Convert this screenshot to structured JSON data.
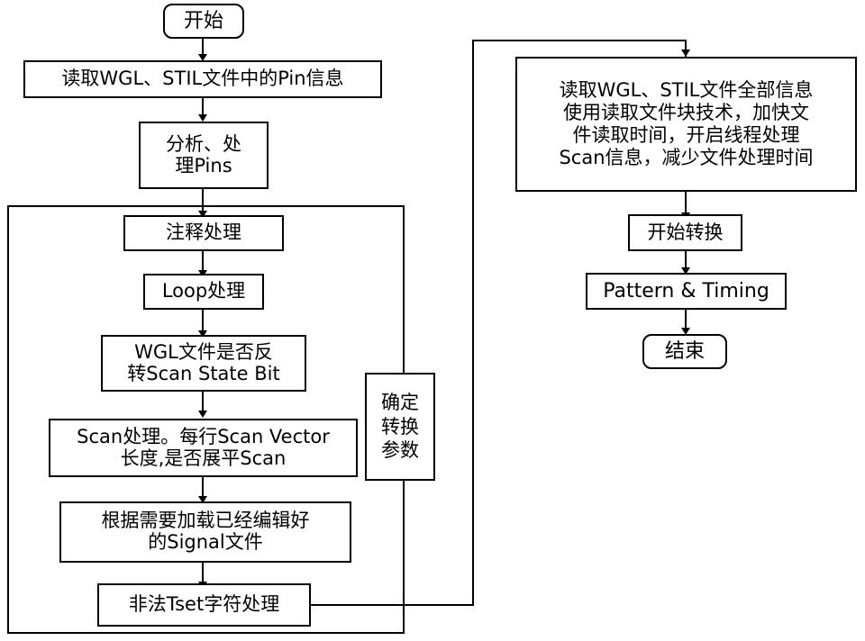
{
  "diagram": {
    "title": "WGL/STIL 文件转换流程图",
    "nodes": {
      "start": {
        "label": "开始",
        "shape": "rounded-rect"
      },
      "read_pin_info": {
        "label": "读取WGL、STIL文件中的Pin信息",
        "shape": "rect"
      },
      "analyze_pins": {
        "label": "分析、处\n理Pins",
        "shape": "rect"
      },
      "comment_process": {
        "label": "注释处理",
        "shape": "rect"
      },
      "loop_process": {
        "label": "Loop处理",
        "shape": "rect"
      },
      "wgl_invert_scan": {
        "label": "WGL文件是否反\n转Scan State Bit",
        "shape": "rect"
      },
      "scan_process": {
        "label": "Scan处理。每行Scan Vector\n长度,是否展平Scan",
        "shape": "rect"
      },
      "load_signal_file": {
        "label": "根据需要加载已经编辑好\n的Signal文件",
        "shape": "rect"
      },
      "illegal_tset": {
        "label": "非法Tset字符处理",
        "shape": "rect"
      },
      "confirm_params": {
        "label": "确定\n转换\n参数",
        "shape": "rect"
      },
      "read_all_info": {
        "label": "读取WGL、STIL文件全部信息\n使用读取文件块技术，加快文\n件读取时间，开启线程处理\nScan信息，减少文件处理时间",
        "shape": "rect"
      },
      "start_convert": {
        "label": "开始转换",
        "shape": "rect"
      },
      "pattern_timing": {
        "label": "Pattern & Timing",
        "shape": "rect"
      },
      "end": {
        "label": "结束",
        "shape": "rounded-rect"
      }
    },
    "colors": {
      "stroke": "#000000",
      "fill": "#ffffff",
      "text": "#000000"
    }
  }
}
